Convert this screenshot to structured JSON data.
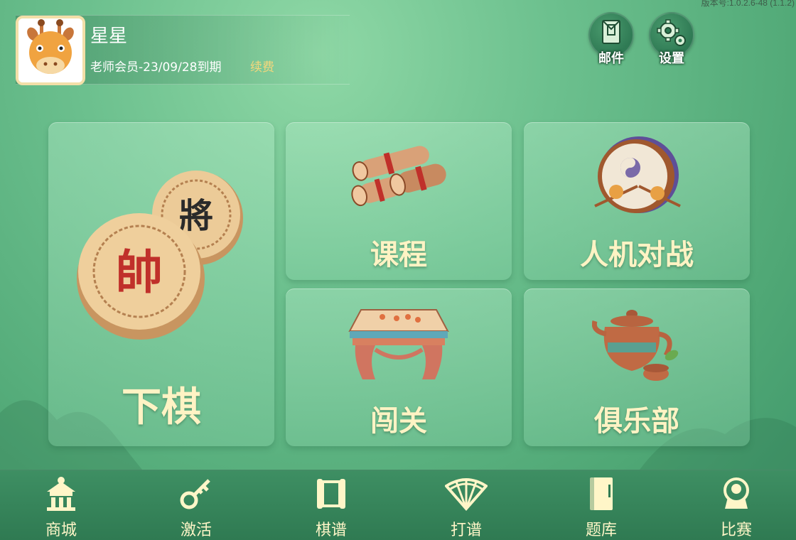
{
  "version": "版本号:1.0.2.6-48 (1.1.2)",
  "profile": {
    "username": "星星",
    "membership": "老师会员-23/09/28到期",
    "renew_label": "续费",
    "avatar_icon": "giraffe-avatar"
  },
  "top_buttons": {
    "mail": {
      "label": "邮件",
      "icon": "mail-icon"
    },
    "settings": {
      "label": "设置",
      "icon": "gear-icon"
    }
  },
  "cards": {
    "play": {
      "label": "下棋",
      "icon": "chess-pieces-icon",
      "piece_red": "帥",
      "piece_black": "將"
    },
    "course": {
      "label": "课程",
      "icon": "scrolls-icon"
    },
    "ai_battle": {
      "label": "人机对战",
      "icon": "drum-icon"
    },
    "challenge": {
      "label": "闯关",
      "icon": "chess-table-icon"
    },
    "club": {
      "label": "俱乐部",
      "icon": "teapot-icon"
    }
  },
  "bottom_nav": [
    {
      "label": "商城",
      "icon": "shop-icon"
    },
    {
      "label": "激活",
      "icon": "key-icon"
    },
    {
      "label": "棋谱",
      "icon": "scroll-icon"
    },
    {
      "label": "打谱",
      "icon": "fan-icon"
    },
    {
      "label": "题库",
      "icon": "book-icon"
    },
    {
      "label": "比赛",
      "icon": "trophy-icon"
    }
  ],
  "colors": {
    "card_label": "#fff3c4",
    "nav_label": "#fff6c8",
    "renew": "#f4d77c",
    "nav_background": "#2f7a52"
  }
}
